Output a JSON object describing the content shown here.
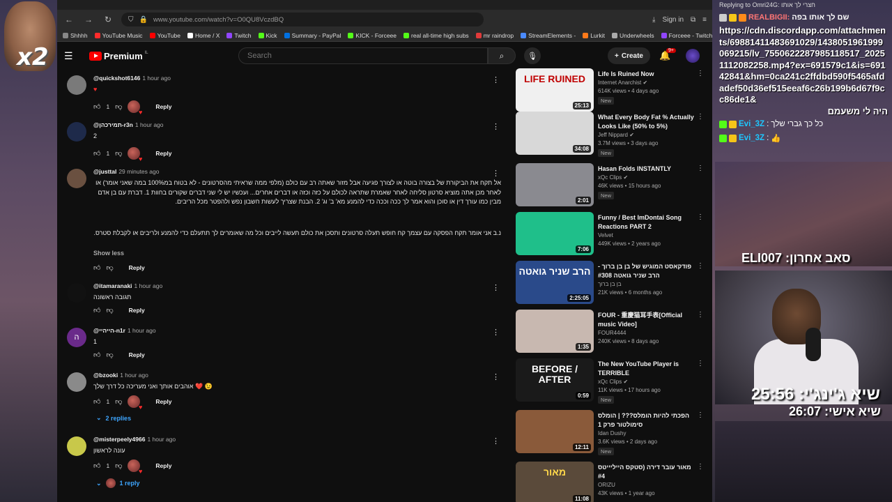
{
  "browser": {
    "url": "www.youtube.com/watch?v=O0QU8VczdBQ",
    "signin": "Sign in",
    "bookmarks": [
      "Shhhh",
      "YouTube Music",
      "YouTube",
      "Home / X",
      "Twitch",
      "Kick",
      "Summary - PayPal",
      "KICK - Forceee",
      "real all-time high subs",
      "mr raindrop",
      "StreamElements -",
      "Lurkit",
      "Underwheels",
      "Forceee - Twitch"
    ]
  },
  "yt": {
    "logo": "Premium",
    "logo_sup": "IL",
    "search_placeholder": "Search",
    "create": "Create",
    "notif_count": "9+"
  },
  "comments": [
    {
      "user": "@quickshot6146",
      "time": "1 hour ago",
      "text": "♥",
      "likes": "1",
      "heart": true,
      "reply": "Reply",
      "avatar": "#7a7a7a",
      "initial": ""
    },
    {
      "user": "@תמירכהן-r3n",
      "time": "1 hour ago",
      "text": "2",
      "likes": "1",
      "heart": true,
      "reply": "Reply",
      "avatar": "#2a3a6a",
      "initial": ""
    },
    {
      "user": "@justtal",
      "time": "29 minutes ago",
      "text": "אל תקח את הביקורת של בצורה בוטה או לצורך פגיעה אבל מזור שאתה רב עם כולם (מלפי ממה שראיתי מהסרטונים - לא בטוח במ100% במה שאני אומר) או לאחר מכן אתה מוציא סרטון סליחה לאחר שאמרת שתראה לכולם על כזה וכזה או דברים אחרים... ועכשיו יש לי שני דברים שקורים בחוות 1. דברת עם בן אדם מבין כמו עורך דין או סוכן והוא אמר לך ככה וככה כדי להמנע מא' ב' וג' 2. הבנת שצריך לעשות חשבון נפש ולהפטר מכל הריבים.",
      "ps": "נ.ב אני אומר תקח הפסקה עם עצמך קח חופש תעלה סרטונים ותסכן את כולם תעשה לייבים וכל מה שאומרים לך תתעלם כדי להמנע ולריבים או לקבלת סטרס.",
      "show_less": "Show less",
      "likes": "",
      "heart": false,
      "reply": "Reply",
      "avatar": "#6a5040",
      "initial": ""
    },
    {
      "user": "@itamaranaki",
      "time": "1 hour ago",
      "text": "תגובה ראשונה",
      "likes": "",
      "heart": false,
      "reply": "Reply",
      "avatar": "#111111",
      "initial": ""
    },
    {
      "user": "@הייהיי-n1r",
      "time": "1 hour ago",
      "text": "1",
      "likes": "",
      "heart": false,
      "reply": "Reply",
      "avatar": "#6a2a8a",
      "initial": "ה"
    },
    {
      "user": "@bzooki",
      "time": "1 hour ago",
      "text": "אוהבים אותך ואני מעריכה כל דרך שלך ❤️ 😉",
      "likes": "1",
      "heart": true,
      "reply": "Reply",
      "avatar": "#8a8a8a",
      "initial": "",
      "replies": "2 replies"
    },
    {
      "user": "@misterpeely4966",
      "time": "1 hour ago",
      "text": "עונה לראשון",
      "likes": "1",
      "heart": true,
      "reply": "Reply",
      "avatar": "#c8c84a",
      "initial": "",
      "replies": "1 reply"
    }
  ],
  "videos": [
    {
      "title": "Life Is Ruined Now",
      "channel": "Internet Anarchist ✔",
      "meta": "614K views • 4 days ago",
      "badge": "New",
      "duration": "25:13",
      "thumb": "LIFE RUINED",
      "bg": "#f0f0f0",
      "fg": "#c00000"
    },
    {
      "title": "What Every Body Fat % Actually Looks Like (50% to 5%)",
      "channel": "Jeff Nippard ✔",
      "meta": "3.7M views • 3 days ago",
      "badge": "New",
      "duration": "34:08",
      "thumb": "",
      "bg": "#d8d8d8",
      "fg": "#222"
    },
    {
      "title": "Hasan Folds INSTANTLY",
      "channel": "xQc Clips ✔",
      "meta": "46K views • 15 hours ago",
      "badge": "New",
      "duration": "2:01",
      "thumb": "",
      "bg": "#8a8a90",
      "fg": "#fff"
    },
    {
      "title": "Funny / Best ImDontai Song Reactions PART 2",
      "channel": "Velvet",
      "meta": "449K views • 2 years ago",
      "badge": "",
      "duration": "7:06",
      "thumb": "",
      "bg": "#1fbf8a",
      "fg": "#fff"
    },
    {
      "title": "פודקאסט המוגיש של בן בן ברוך - הרב שניר גואטה #308",
      "channel": "בן בן ברוך",
      "meta": "21K views • 6 months ago",
      "badge": "",
      "duration": "2:25:05",
      "thumb": "הרב שניר גואטה",
      "bg": "#2a4a8a",
      "fg": "#fff"
    },
    {
      "title": "FOUR - 重慶猫耳手表[Official music Video]",
      "channel": "FOUR4444",
      "meta": "240K views • 8 days ago",
      "badge": "",
      "duration": "1:35",
      "thumb": "",
      "bg": "#c8b8b0",
      "fg": "#fff"
    },
    {
      "title": "The New YouTube Player is TERRIBLE",
      "channel": "xQc Clips ✔",
      "meta": "11K views • 17 hours ago",
      "badge": "New",
      "duration": "0:59",
      "thumb": "BEFORE / AFTER",
      "bg": "#1a1a1a",
      "fg": "#fff"
    },
    {
      "title": "הפכתי להיות הומלס??? | הומלס סימולטור פרק 1",
      "channel": "Idan Dushy",
      "meta": "3.6K views • 2 days ago",
      "badge": "New",
      "duration": "12:11",
      "thumb": "",
      "bg": "#8a5a3a",
      "fg": "#fff"
    },
    {
      "title": "מאור עובר דירה (סטקס הייליייטס #4",
      "channel": "ORIZU",
      "meta": "43K views • 1 year ago",
      "badge": "",
      "duration": "11:08",
      "thumb": "מאור",
      "bg": "#5a4a3a",
      "fg": "#ffd84a"
    }
  ],
  "stream": {
    "x2": "x2",
    "replying": "Replying to Omri24G: חצרי לך אותו",
    "badge_user": "REALBIGII:",
    "badge_msg": "שם לך אותו בפה",
    "url": "https://cdn.discordapp.com/attachments/698814114836910​29/1438051961999069215/lv_7550622287985118517_20251112082258.mp4?ex=691579c1&is=69142841&hm=0ca241c2ffdbd590f5465afdadef50d36ef515eeaf6c26b199b6d67f9cc86de1&",
    "url_tail": "היה לי משעמם",
    "chat1_user": "Evi_3Z",
    "chat1_msg": "כל כך גברי שלך",
    "chat2_user": "Evi_3Z",
    "chat2_msg": "👍",
    "sub_label": "סאב אחרון: ELI007",
    "timer_main": "שיא ג'ינג'י: 25:56",
    "timer_sub": "שיא אישי: 26:07"
  }
}
